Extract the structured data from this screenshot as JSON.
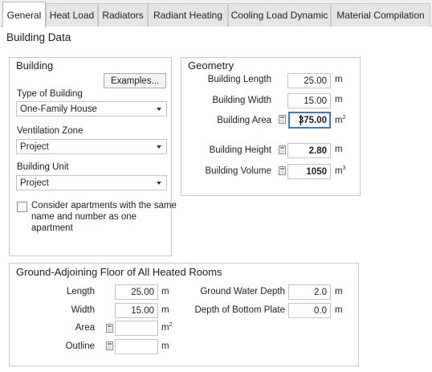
{
  "tabs": [
    "General",
    "Heat Load",
    "Radiators",
    "Radiant Heating",
    "Cooling Load Dynamic",
    "Material Compilation"
  ],
  "active_tab": "General",
  "section_title": "Building Data",
  "building": {
    "title": "Building",
    "examples_button": "Examples...",
    "type_label": "Type of Building",
    "type_value": "One-Family House",
    "ventilation_label": "Ventilation Zone",
    "ventilation_value": "Project",
    "unit_label": "Building Unit",
    "unit_value": "Project",
    "checkbox_checked": false,
    "checkbox_lines": [
      "Consider apartments with the same",
      "name and number as one",
      "apartment"
    ]
  },
  "geometry": {
    "title": "Geometry",
    "length_label": "Building Length",
    "length_value": "25.00",
    "length_unit": "m",
    "width_label": "Building Width",
    "width_value": "15.00",
    "width_unit": "m",
    "area_label": "Building Area",
    "area_value": "375.00",
    "area_unit": "m",
    "area_unit_sup": "2",
    "height_label": "Building Height",
    "height_value": "2.80",
    "height_unit": "m",
    "volume_label": "Building Volume",
    "volume_value": "1050",
    "volume_unit": "m",
    "volume_unit_sup": "3"
  },
  "floor": {
    "title": "Ground-Adjoining Floor of All Heated Rooms",
    "length_label": "Length",
    "length_value": "25.00",
    "length_unit": "m",
    "width_label": "Width",
    "width_value": "15.00",
    "width_unit": "m",
    "area_label": "Area",
    "area_value": "",
    "area_unit": "m",
    "area_unit_sup": "2",
    "outline_label": "Outline",
    "outline_value": "",
    "outline_unit": "m",
    "gw_label": "Ground Water Depth",
    "gw_value": "2.0",
    "gw_unit": "m",
    "bp_label": "Depth of Bottom Plate",
    "bp_value": "0.0",
    "bp_unit": "m"
  }
}
